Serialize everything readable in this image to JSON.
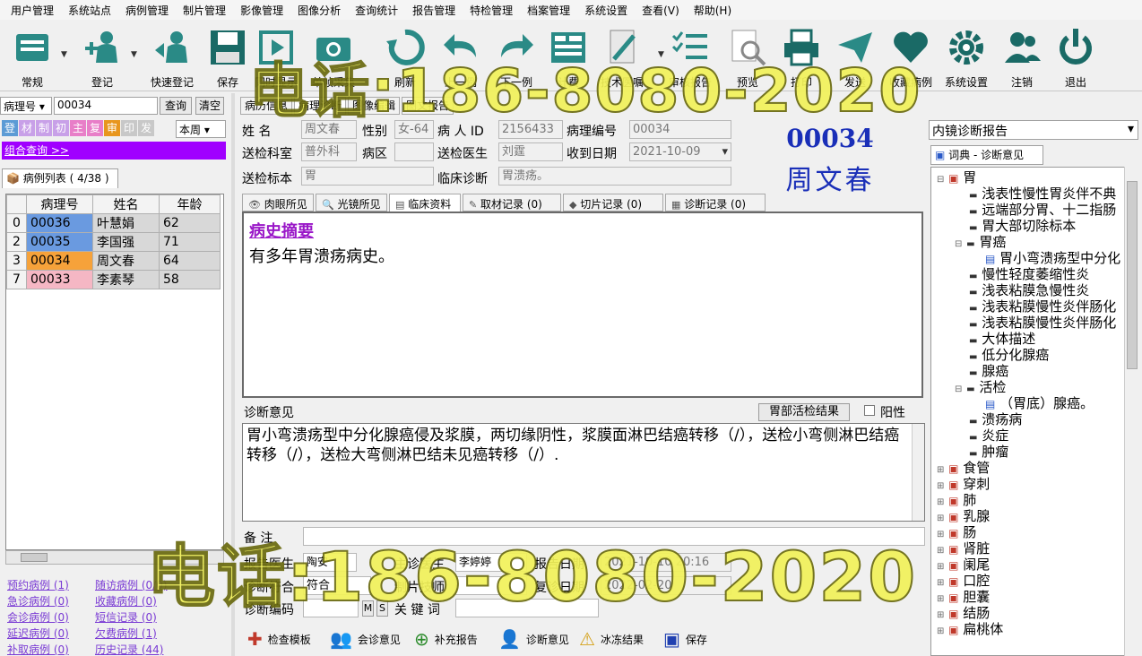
{
  "menu": [
    "用户管理",
    "系统站点",
    "病例管理",
    "制片管理",
    "影像管理",
    "图像分析",
    "查询统计",
    "报告管理",
    "特检管理",
    "档案管理",
    "系统设置",
    "查看(V)",
    "帮助(H)"
  ],
  "toolbar": [
    {
      "label": "常规",
      "icon": "form-icon"
    },
    {
      "label": "登记",
      "icon": "add-person-icon"
    },
    {
      "label": "快速登记",
      "icon": "quick-register-icon"
    },
    {
      "label": "保存",
      "icon": "floppy-icon"
    },
    {
      "label": "同时显示",
      "icon": "play-icon"
    },
    {
      "label": "单帧采集",
      "icon": "camera-icon"
    },
    {
      "label": "刷新",
      "icon": "refresh-icon"
    },
    {
      "label": "上一例",
      "icon": "back-icon"
    },
    {
      "label": "下一例",
      "icon": "forward-icon"
    },
    {
      "label": "计费",
      "icon": "billing-icon"
    },
    {
      "label": "技术医嘱",
      "icon": "syringe-icon"
    },
    {
      "label": "审核报告",
      "icon": "checklist-icon"
    },
    {
      "label": "预览",
      "icon": "preview-icon"
    },
    {
      "label": "打印",
      "icon": "printer-icon"
    },
    {
      "label": "发送",
      "icon": "send-icon"
    },
    {
      "label": "收藏病例",
      "icon": "heart-icon"
    },
    {
      "label": "系统设置",
      "icon": "gear-icon"
    },
    {
      "label": "注销",
      "icon": "users-icon"
    },
    {
      "label": "退出",
      "icon": "power-icon"
    }
  ],
  "search": {
    "field": "病理号",
    "value": "00034",
    "query_btn": "查询",
    "clear_btn": "清空",
    "period": "本周"
  },
  "flags": [
    "登",
    "材",
    "制",
    "初",
    "主",
    "复",
    "审",
    "印",
    "发"
  ],
  "combo_query": "组合查询 >>",
  "case_list": {
    "tab": "病例列表 ( 4/38 )",
    "headers": [
      "病理号",
      "姓名",
      "年龄"
    ],
    "rows": [
      {
        "idx": "0",
        "id": "00036",
        "name": "叶慧娟",
        "age": "62",
        "color": "#6a9ae0"
      },
      {
        "idx": "2",
        "id": "00035",
        "name": "李国强",
        "age": "71",
        "color": "#6a9ae0"
      },
      {
        "idx": "3",
        "id": "00034",
        "name": "周文春",
        "age": "64",
        "color": "#f6a23a"
      },
      {
        "idx": "7",
        "id": "00033",
        "name": "李素琴",
        "age": "58",
        "color": "#f5b7c4"
      }
    ]
  },
  "left_links": [
    [
      "预约病例 (1)",
      "随访病例 (0/0)"
    ],
    [
      "急诊病例 (0)",
      "收藏病例 (0)"
    ],
    [
      "会诊病例 (0)",
      "短信记录 (0)"
    ],
    [
      "延迟病例 (0)",
      "欠费病例 (1)"
    ],
    [
      "补取病例 (0)",
      "历史记录 (44)"
    ]
  ],
  "main_tabs": [
    "病历信息",
    "病理诊断",
    "图像编辑",
    "图文报告"
  ],
  "patient": {
    "name_label": "姓    名",
    "name": "周文春",
    "sex_label": "性别",
    "sex": "女-64",
    "inpatient_label": "病 人 ID",
    "inpatient": "2156433",
    "path_no_label": "病理编号",
    "path_no": "00034",
    "dept_label": "送检科室",
    "dept": "普外科",
    "ward_label": "病区",
    "ward": "",
    "doctor_label": "送检医生",
    "doctor": "刘霆",
    "recv_label": "收到日期",
    "recv": "2021-10-09",
    "specimen_label": "送检标本",
    "specimen": "胃",
    "clinical_label": "临床诊断",
    "clinical": "胃溃疡。",
    "big_id": "00034",
    "big_name": "周文春"
  },
  "sub_tabs": [
    "肉眼所见",
    "光镜所见",
    "临床资料",
    "取材记录 (0)",
    "切片记录 (0)",
    "诊断记录 (0)"
  ],
  "history_title": "病史摘要",
  "history_text": "有多年胃溃疡病史。",
  "diag_label": "诊断意见",
  "diag_btn": "胃部活检结果",
  "positive_label": "阳性",
  "diag_text": "胃小弯溃疡型中分化腺癌侵及浆膜，两切缘阴性，浆膜面淋巴结癌转移（/），送检小弯侧淋巴结癌转移（/），送检大弯侧淋巴结未见癌转移（/）.",
  "footer": {
    "remark_label": "备    注",
    "report_doc_label": "报告医生",
    "report_doc": "陶安",
    "chief_doc_label": "主诊医生",
    "chief_doc": "李婷婷",
    "report_date_label": "报告日期",
    "report_date": "2021-10-10 20:16",
    "match_label": "诊断符合",
    "match": "符合",
    "tech_label": "制片技师",
    "review_label": "复诊日期",
    "review_date": "2022-02-20",
    "code_label": "诊断编码",
    "m_btn": "M",
    "s_btn": "S",
    "keyword_label": "关 键 词"
  },
  "actions": [
    "检查模板",
    "会诊意见",
    "补充报告",
    "诊断意见",
    "冰冻结果",
    "保存"
  ],
  "right": {
    "report_type": "内镜诊断报告",
    "tree_tab": "词典 - 诊断意见",
    "tree": [
      {
        "text": "胃",
        "level": 0,
        "type": "book"
      },
      {
        "text": "浅表性慢性胃炎伴不典",
        "level": 1,
        "type": "leaf"
      },
      {
        "text": "远端部分胃、十二指肠",
        "level": 1,
        "type": "leaf"
      },
      {
        "text": "胃大部切除标本",
        "level": 1,
        "type": "leaf"
      },
      {
        "text": "胃癌",
        "level": 1,
        "type": "open"
      },
      {
        "text": "胃小弯溃疡型中分化",
        "level": 2,
        "type": "doc"
      },
      {
        "text": "慢性轻度萎缩性炎",
        "level": 1,
        "type": "leaf"
      },
      {
        "text": "浅表粘膜急慢性炎",
        "level": 1,
        "type": "leaf"
      },
      {
        "text": "浅表粘膜慢性炎伴肠化",
        "level": 1,
        "type": "leaf"
      },
      {
        "text": "浅表粘膜慢性炎伴肠化",
        "level": 1,
        "type": "leaf"
      },
      {
        "text": "大体描述",
        "level": 1,
        "type": "leaf"
      },
      {
        "text": "低分化腺癌",
        "level": 1,
        "type": "leaf"
      },
      {
        "text": "腺癌",
        "level": 1,
        "type": "leaf"
      },
      {
        "text": "活检",
        "level": 1,
        "type": "open"
      },
      {
        "text": "（胃底）腺癌。",
        "level": 2,
        "type": "doc"
      },
      {
        "text": "溃疡病",
        "level": 1,
        "type": "leaf"
      },
      {
        "text": "炎症",
        "level": 1,
        "type": "leaf"
      },
      {
        "text": "肿瘤",
        "level": 1,
        "type": "leaf"
      },
      {
        "text": "食管",
        "level": 0,
        "type": "book"
      },
      {
        "text": "穿刺",
        "level": 0,
        "type": "book"
      },
      {
        "text": "肺",
        "level": 0,
        "type": "book"
      },
      {
        "text": "乳腺",
        "level": 0,
        "type": "book"
      },
      {
        "text": "肠",
        "level": 0,
        "type": "book"
      },
      {
        "text": "肾脏",
        "level": 0,
        "type": "book"
      },
      {
        "text": "阑尾",
        "level": 0,
        "type": "book"
      },
      {
        "text": "口腔",
        "level": 0,
        "type": "book"
      },
      {
        "text": "胆囊",
        "level": 0,
        "type": "book"
      },
      {
        "text": "结肠",
        "level": 0,
        "type": "book"
      },
      {
        "text": "扁桃体",
        "level": 0,
        "type": "book"
      }
    ]
  },
  "watermark": "电话:186-8080-2020"
}
